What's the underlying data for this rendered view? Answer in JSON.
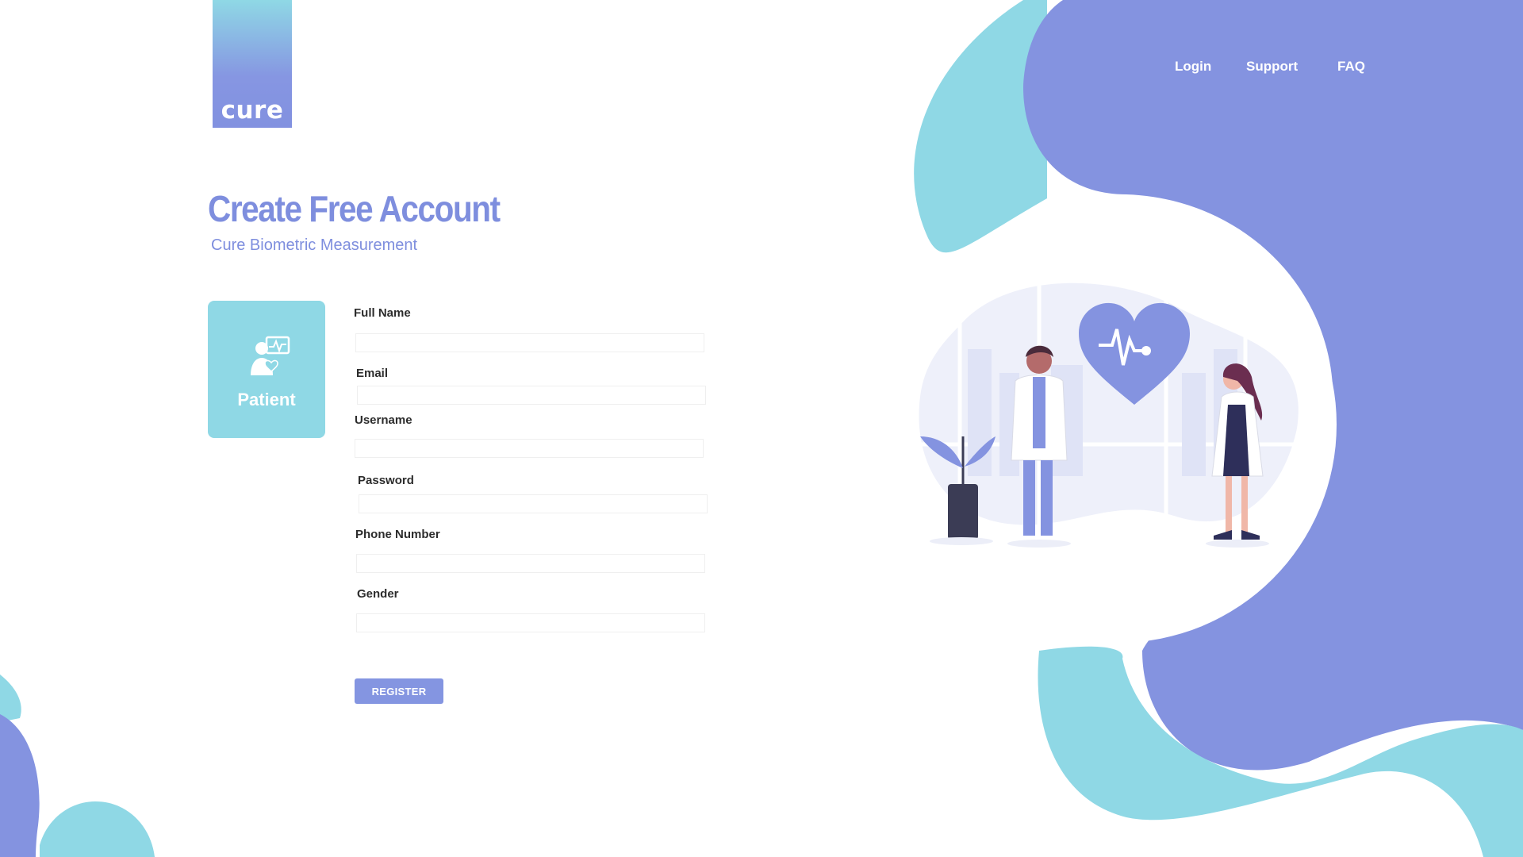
{
  "brand": {
    "logo_text": "cure"
  },
  "nav": {
    "login": "Login",
    "support": "Support",
    "faq": "FAQ"
  },
  "header": {
    "title": "Create Free Account",
    "subtitle": "Cure Biometric Measurement"
  },
  "role_card": {
    "label": "Patient",
    "icon": "patient-monitor-icon"
  },
  "form": {
    "fields": [
      {
        "label": "Full Name",
        "value": "",
        "placeholder": ""
      },
      {
        "label": "Email",
        "value": "",
        "placeholder": ""
      },
      {
        "label": "Username",
        "value": "",
        "placeholder": ""
      },
      {
        "label": "Password",
        "value": "",
        "placeholder": ""
      },
      {
        "label": "Phone Number",
        "value": "",
        "placeholder": ""
      },
      {
        "label": "Gender",
        "value": "",
        "placeholder": ""
      }
    ],
    "submit_label": "REGISTER"
  },
  "colors": {
    "primary": "#8495e1",
    "accent": "#8fd8e5",
    "title": "#7e8ede",
    "text": "#2c2c2c"
  }
}
